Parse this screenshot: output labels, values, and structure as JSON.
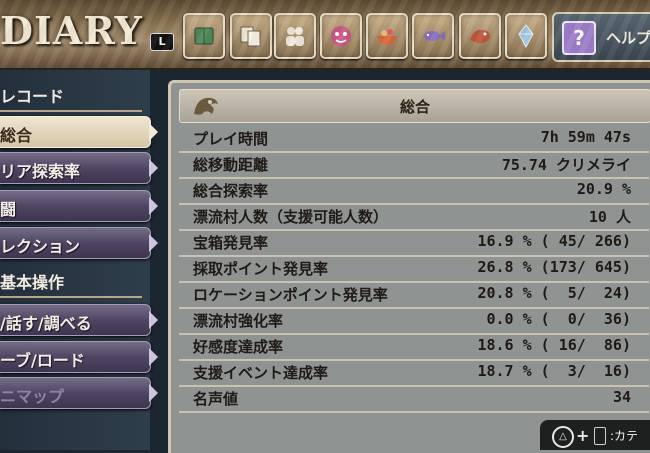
{
  "app": {
    "title": "DIARY",
    "l_button": "L"
  },
  "tabs": [
    {
      "name": "book-icon",
      "color": "#4f8a5a"
    },
    {
      "name": "documents-icon",
      "color": "#e9e4d6"
    },
    {
      "name": "people-icon",
      "color": "#e9e4d6"
    },
    {
      "name": "monster-face-icon",
      "color": "#c95a86"
    },
    {
      "name": "food-bowl-icon",
      "color": "#d8683c"
    },
    {
      "name": "fish-icon",
      "color": "#8a6fbe"
    },
    {
      "name": "creature-icon",
      "color": "#c0563e"
    },
    {
      "name": "crystal-icon",
      "color": "#9fc6dc"
    }
  ],
  "help": {
    "icon": "?",
    "label": "ヘルプ"
  },
  "sidebar": {
    "header_record": "レコード",
    "header_basic": "基本操作",
    "items": [
      {
        "label": "総合"
      },
      {
        "label": "リア探索率"
      },
      {
        "label": "闘"
      },
      {
        "label": "レクション"
      },
      {
        "label": "/話す/調べる"
      },
      {
        "label": "ーブ/ロード"
      },
      {
        "label": "ニマップ"
      }
    ]
  },
  "panel": {
    "title": "総合",
    "rows": [
      {
        "label": "プレイ時間",
        "value": "7h 59m 47s"
      },
      {
        "label": "総移動距離",
        "value": "75.74 クリメライ"
      },
      {
        "label": "総合探索率",
        "value": "20.9 %"
      },
      {
        "label": "漂流村人数（支援可能人数）",
        "value": "10 人"
      },
      {
        "label": "宝箱発見率",
        "value": "16.9 % ( 45/ 266)"
      },
      {
        "label": "採取ポイント発見率",
        "value": "26.8 % (173/ 645)"
      },
      {
        "label": "ロケーションポイント発見率",
        "value": "20.8 % (  5/  24)"
      },
      {
        "label": "漂流村強化率",
        "value": "0.0 % (  0/  36)"
      },
      {
        "label": "好感度達成率",
        "value": "18.6 % ( 16/  86)"
      },
      {
        "label": "支援イベント達成率",
        "value": "18.7 % (  3/  16)"
      },
      {
        "label": "名声値",
        "value": "34"
      }
    ]
  },
  "controls": {
    "text": ":カテ"
  }
}
